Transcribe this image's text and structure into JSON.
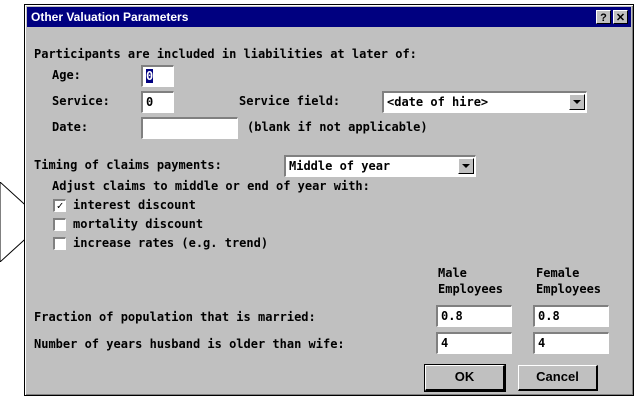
{
  "window": {
    "title": "Other Valuation Parameters",
    "help_label": "?",
    "close_label": "✕"
  },
  "participants": {
    "heading": "Participants are included in liabilities at later of:",
    "age_label": "Age:",
    "age_value": "0",
    "service_label": "Service:",
    "service_value": "0",
    "service_field_label": "Service field:",
    "service_field_value": "<date of hire>",
    "date_label": "Date:",
    "date_value": "",
    "date_hint": "(blank if not applicable)"
  },
  "claims": {
    "timing_label": "Timing of claims payments:",
    "timing_value": "Middle of year",
    "adjust_label": "Adjust claims to middle or end of year with:",
    "options": [
      {
        "label": "interest discount",
        "checked": true
      },
      {
        "label": "mortality discount",
        "checked": false
      },
      {
        "label": "increase rates (e.g. trend)",
        "checked": false
      }
    ]
  },
  "table": {
    "col_male_1": "Male",
    "col_male_2": "Employees",
    "col_female_1": "Female",
    "col_female_2": "Employees",
    "married_label": "Fraction of population that is married:",
    "married_male": "0.8",
    "married_female": "0.8",
    "age_diff_label": "Number of years husband is older than wife:",
    "age_diff_male": "4",
    "age_diff_female": "4"
  },
  "buttons": {
    "ok_label": "OK",
    "cancel_label": "Cancel"
  }
}
